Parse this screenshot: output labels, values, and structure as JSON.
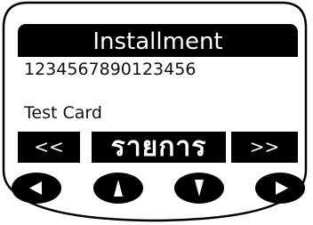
{
  "screen": {
    "title": "Installment",
    "line1": "1234567890123456",
    "line2": "Test Card"
  },
  "softkeys": {
    "left": "<<",
    "middle": "รายการ",
    "right": ">>"
  },
  "nav_buttons": [
    {
      "icon": "left-arrow-icon"
    },
    {
      "icon": "up-arrow-icon"
    },
    {
      "icon": "down-arrow-icon"
    },
    {
      "icon": "right-arrow-icon"
    }
  ],
  "colors": {
    "screen_bar": "#000000",
    "button": "#000000",
    "bezel": "#ffffff",
    "outline": "#000000"
  }
}
